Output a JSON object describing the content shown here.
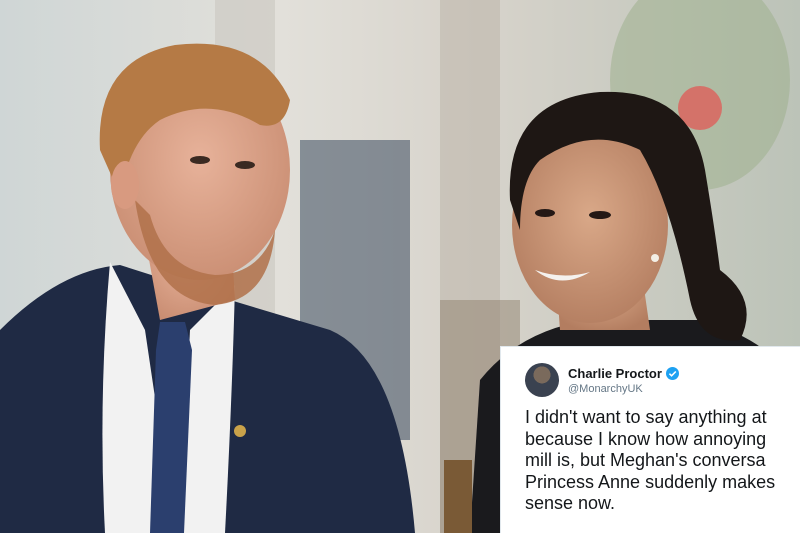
{
  "tweet": {
    "author_name": "Charlie Proctor",
    "author_handle": "@MonarchyUK",
    "lines": [
      "I didn't want to say anything at",
      "because I know how annoying",
      "mill is, but Meghan's conversa",
      "Princess Anne suddenly makes",
      "sense now."
    ]
  },
  "icons": {
    "verified": "verified-badge-icon",
    "avatar": "avatar"
  },
  "colors": {
    "verified_blue": "#1da1f2",
    "tweet_text": "#14171a",
    "handle_gray": "#657786"
  }
}
